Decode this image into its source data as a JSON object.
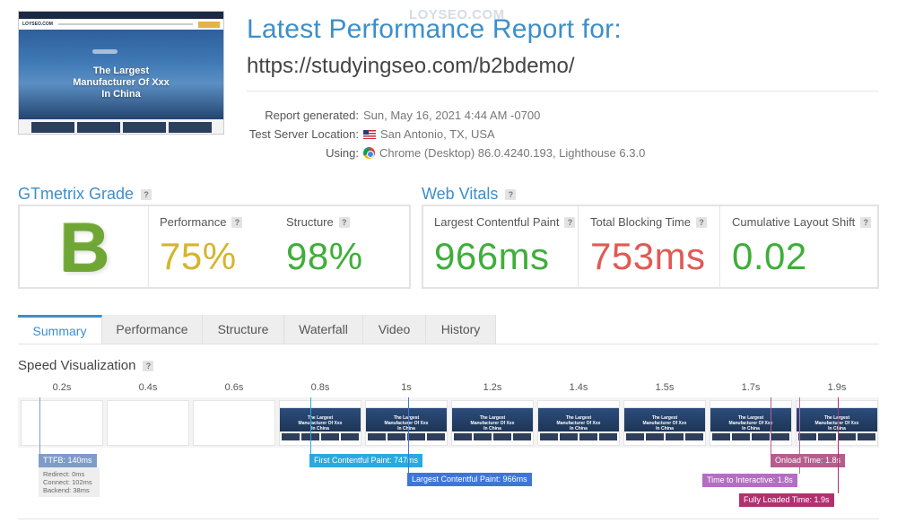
{
  "watermark": "LOYSEO.COM",
  "header": {
    "title": "Latest Performance Report for:",
    "url": "https://studyingseo.com/b2bdemo/"
  },
  "thumbnail": {
    "logo": "LOYSEO.COM",
    "hero_line1": "The Largest",
    "hero_line2": "Manufacturer Of Xxx",
    "hero_line3": "In China"
  },
  "meta": {
    "report_label": "Report generated:",
    "report_value": "Sun, May 16, 2021 4:44 AM -0700",
    "location_label": "Test Server Location:",
    "location_value": "San Antonio, TX, USA",
    "location_icon": "us-flag-icon",
    "using_label": "Using:",
    "using_value": "Chrome (Desktop) 86.0.4240.193, Lighthouse 6.3.0",
    "using_icon": "chrome-icon"
  },
  "grade": {
    "heading": "GTmetrix Grade",
    "letter": "B",
    "performance_label": "Performance",
    "performance_value": "75%",
    "structure_label": "Structure",
    "structure_value": "98%",
    "colors": {
      "grade": "#8bc34a",
      "performance": "#d4b52e",
      "structure": "#3fae3a"
    }
  },
  "web_vitals": {
    "heading": "Web Vitals",
    "lcp_label": "Largest Contentful Paint",
    "lcp_value": "966ms",
    "tbt_label": "Total Blocking Time",
    "tbt_value": "753ms",
    "cls_label": "Cumulative Layout Shift",
    "cls_value": "0.02",
    "colors": {
      "lcp": "#3fae3a",
      "tbt": "#e05a55",
      "cls": "#3fae3a"
    }
  },
  "tabs": [
    "Summary",
    "Performance",
    "Structure",
    "Waterfall",
    "Video",
    "History"
  ],
  "active_tab": "Summary",
  "speed": {
    "heading": "Speed Visualization",
    "times": [
      "0.2s",
      "0.4s",
      "0.6s",
      "0.8s",
      "1s",
      "1.2s",
      "1.4s",
      "1.5s",
      "1.7s",
      "1.9s"
    ],
    "frame_text": [
      "The Largest",
      "Manufacturer Of Xxx",
      "In China"
    ],
    "ttfb": "TTFB: 140ms",
    "ttfb_details": [
      "Redirect: 0ms",
      "Connect: 102ms",
      "Backend: 38ms"
    ],
    "fcp": "First Contentful Paint: 747ms",
    "lcp": "Largest Contentful Paint: 966ms",
    "tti": "Time to Interactive: 1.8s",
    "onload": "Onload Time: 1.8s",
    "fully_loaded": "Fully Loaded Time: 1.9s",
    "colors": {
      "ttfb": "#7f9cc9",
      "fcp": "#2aa9e0",
      "lcp": "#3f76d6",
      "tti": "#b56cc4",
      "onload": "#b55e8e",
      "fully_loaded": "#b3306f"
    }
  }
}
